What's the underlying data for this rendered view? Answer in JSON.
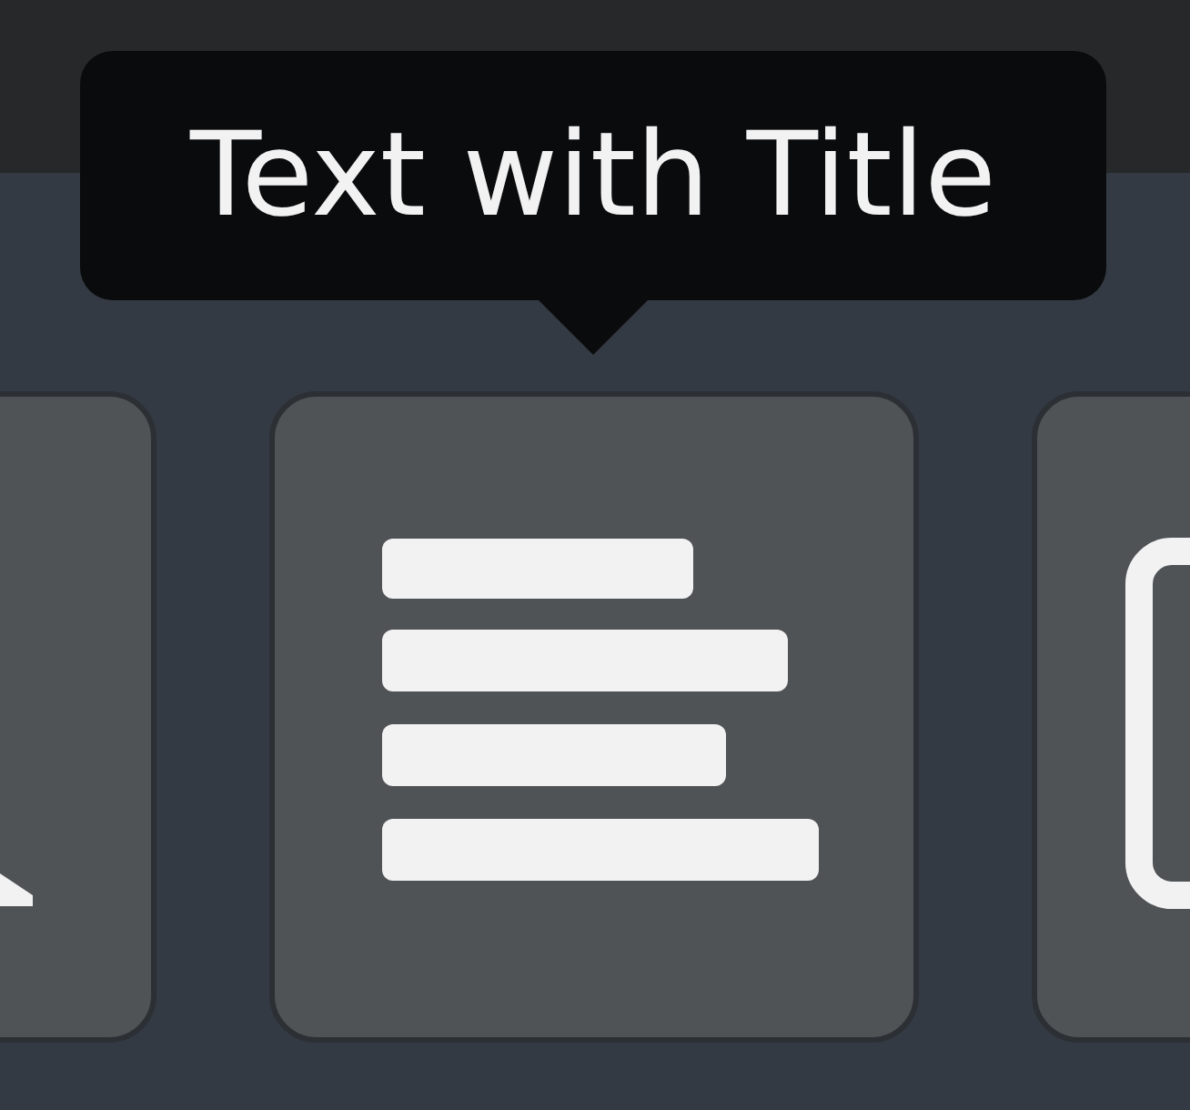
{
  "tooltip": {
    "text": "Text with Title"
  },
  "cards": [
    {
      "kind": "image"
    },
    {
      "kind": "text"
    },
    {
      "kind": "contact"
    }
  ]
}
